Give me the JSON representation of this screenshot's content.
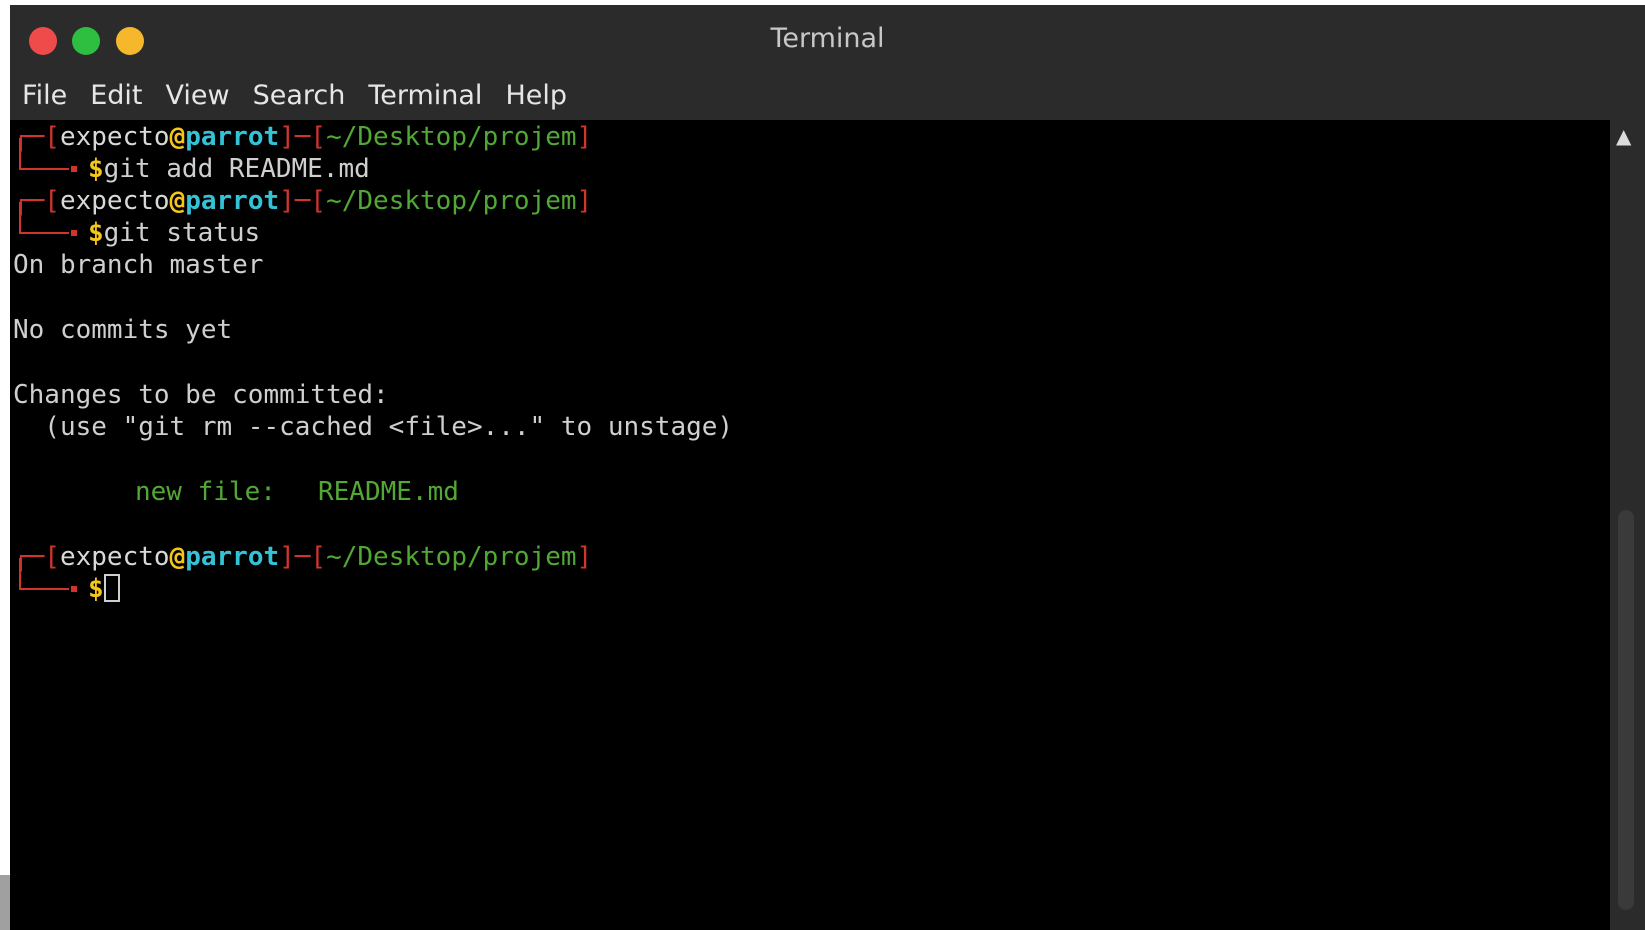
{
  "window": {
    "title": "Terminal"
  },
  "menubar": {
    "items": [
      "File",
      "Edit",
      "View",
      "Search",
      "Terminal",
      "Help"
    ]
  },
  "prompt": {
    "user": "expecto",
    "at": "@",
    "host": "parrot",
    "path": "~/Desktop/projem",
    "dollar": "$"
  },
  "commands": [
    "git add README.md",
    "git status"
  ],
  "output": {
    "branch": "On branch master",
    "no_commits": "No commits yet",
    "changes_header": "Changes to be committed:",
    "unstage_hint": "  (use \"git rm --cached <file>...\" to unstage)",
    "new_file_label": "new file:",
    "new_file_name": "README.md"
  },
  "colors": {
    "prompt_bracket": "#d0342c",
    "at_sign": "#f5c518",
    "host": "#34c2d6",
    "path": "#52a835",
    "staged_file": "#52a835"
  },
  "icons": {
    "close": "close-button",
    "maximize": "maximize-button",
    "minimize": "minimize-button",
    "scroll_up": "scroll-up-arrow-icon"
  }
}
